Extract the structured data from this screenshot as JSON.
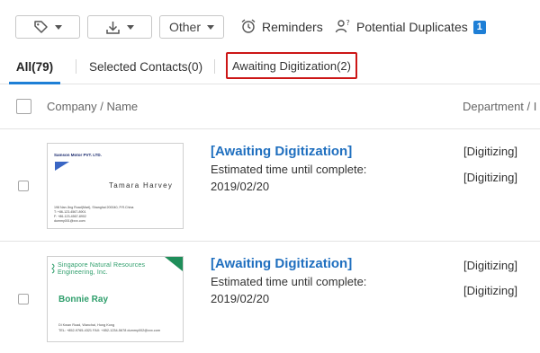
{
  "toolbar": {
    "other_label": "Other",
    "reminders_label": "Reminders",
    "duplicates_label": "Potential Duplicates",
    "duplicates_count": "1"
  },
  "tabs": {
    "all_label": "All(79)",
    "selected_label": "Selected Contacts(0)",
    "awaiting_label": "Awaiting Digitization(2)"
  },
  "table": {
    "col_company": "Company / Name",
    "col_department": "Department / I"
  },
  "rows": [
    {
      "title": "[Awaiting Digitization]",
      "est_label": "Estimated time until complete:",
      "date": "2019/02/20",
      "dept1": "[Digitizing]",
      "dept2": "[Digitizing]",
      "card": {
        "company": "Samson Motor PVT. LTD.",
        "name": "Tamara Harvey",
        "line1": "198 Nan Jing Road(Mart), Shanghai 200040, P.R.China",
        "line2": "T: +86-123-4567-8901",
        "line3": "F: +86-123-4567-8902",
        "line4": "dummy001@xxx.com"
      }
    },
    {
      "title": "[Awaiting Digitization]",
      "est_label": "Estimated time until complete:",
      "date": "2019/02/20",
      "dept1": "[Digitizing]",
      "dept2": "[Digitizing]",
      "card": {
        "company_line1": "Singapore Natural Resources",
        "company_line2": "Engineering, Inc.",
        "name": "Bonnie Ray",
        "line1": "Di Kwan Road, Wanchai, Hong Kong",
        "line2": "TEL: +852-9765-4321    FAX: +852-1234-5678    dummy002@xxx.com"
      }
    }
  ]
}
